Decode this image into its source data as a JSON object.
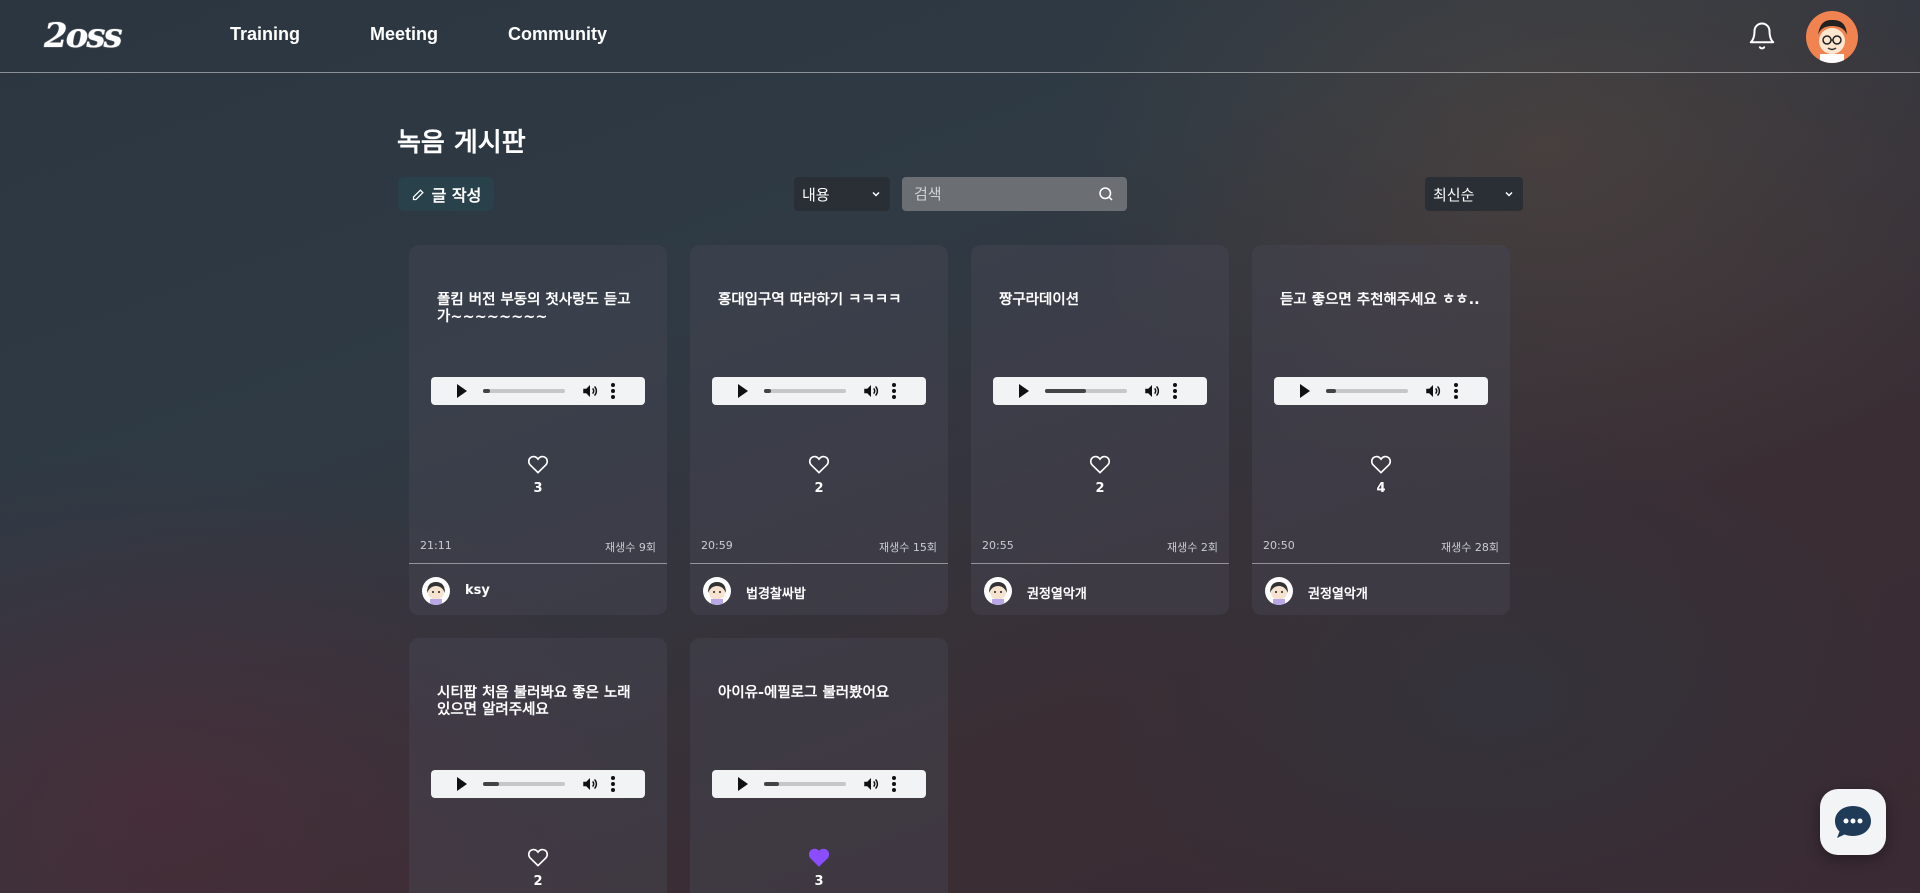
{
  "header": {
    "logo_text": "2oss",
    "nav": [
      "Training",
      "Meeting",
      "Community"
    ]
  },
  "page": {
    "title": "녹음 게시판",
    "write_button": "글 작성",
    "filter_select": "내용",
    "search_placeholder": "검색",
    "sort_select": "최신순"
  },
  "colors": {
    "liked_heart": "#8a4dff",
    "write_button_bg": "#28414a",
    "avatar_orange": "#f08350"
  },
  "posts": [
    {
      "title": "폴킴 버전 부동의 첫사랑도 듣고 가~~~~~~~~",
      "likes": "3",
      "liked": false,
      "time": "21:11",
      "plays": "재생수 9회",
      "user": "ksy",
      "progress": 0.08
    },
    {
      "title": "홍대입구역 따라하기 ㅋㅋㅋㅋ",
      "likes": "2",
      "liked": false,
      "time": "20:59",
      "plays": "재생수 15회",
      "user": "법경찰싸밥",
      "progress": 0.08
    },
    {
      "title": "짱구라데이션",
      "likes": "2",
      "liked": false,
      "time": "20:55",
      "plays": "재생수 2회",
      "user": "권정열악개",
      "progress": 0.5
    },
    {
      "title": "듣고 좋으면 추천해주세요 ㅎㅎ..",
      "likes": "4",
      "liked": false,
      "time": "20:50",
      "plays": "재생수 28회",
      "user": "권정열악개",
      "progress": 0.12
    },
    {
      "title": "시티팝 처음 불러봐요 좋은 노래 있으면 알려주세요",
      "likes": "2",
      "liked": false,
      "time": "",
      "plays": "",
      "user": "",
      "progress": 0.2
    },
    {
      "title": "아이유-에필로그 불러봤어요",
      "likes": "3",
      "liked": true,
      "time": "",
      "plays": "",
      "user": "",
      "progress": 0.18
    }
  ]
}
